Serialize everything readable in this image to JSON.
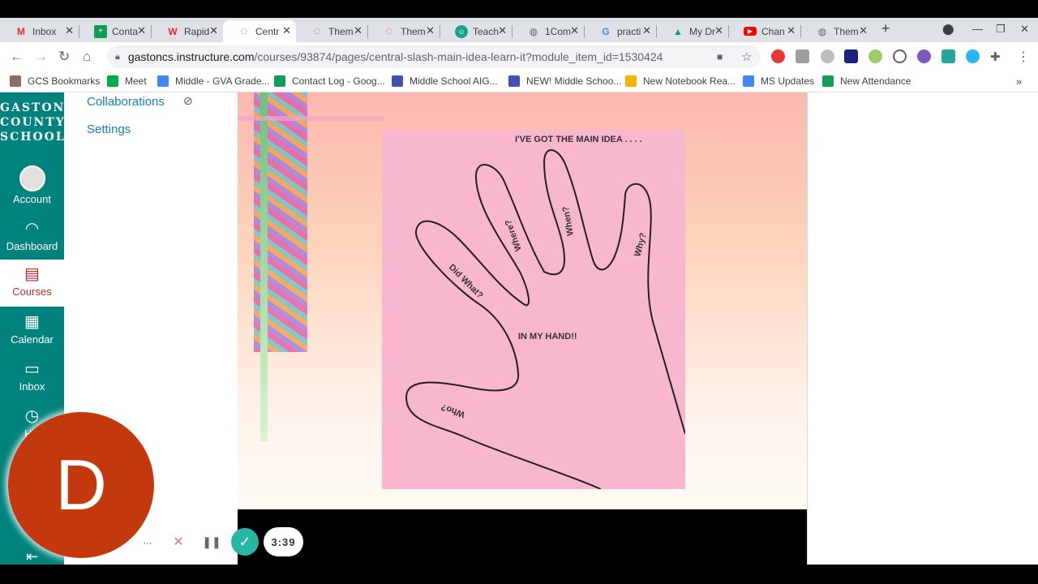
{
  "tabs": [
    {
      "icon": "gmail-icon",
      "label": "Inbox",
      "active": false
    },
    {
      "icon": "sheets-icon",
      "label": "Conta",
      "active": false
    },
    {
      "icon": "rapid-icon",
      "label": "Rapid",
      "active": false
    },
    {
      "icon": "canvas-icon",
      "label": "Centr",
      "active": true
    },
    {
      "icon": "canvas-icon",
      "label": "Them",
      "active": false
    },
    {
      "icon": "canvas-icon",
      "label": "Them",
      "active": false
    },
    {
      "icon": "teach-icon",
      "label": "Teach",
      "active": false
    },
    {
      "icon": "globe-icon",
      "label": "1Com",
      "active": false
    },
    {
      "icon": "google-icon",
      "label": "practi",
      "active": false
    },
    {
      "icon": "drive-icon",
      "label": "My Dr",
      "active": false
    },
    {
      "icon": "youtube-icon",
      "label": "Chan",
      "active": false
    },
    {
      "icon": "globe-icon",
      "label": "Them",
      "active": false
    }
  ],
  "address_bar": {
    "domain": "gastoncs.instructure.com",
    "path": "/courses/93874/pages/central-slash-main-idea-learn-it?module_item_id=1530424"
  },
  "bookmarks": [
    {
      "label": "GCS Bookmarks",
      "color": "#8d6e63"
    },
    {
      "label": "Meet",
      "color": "#00ac47"
    },
    {
      "label": "Middle - GVA Grade...",
      "color": "#4285f4"
    },
    {
      "label": "Contact Log - Goog...",
      "color": "#0f9d58"
    },
    {
      "label": "Middle School AIG...",
      "color": "#3f51b5"
    },
    {
      "label": "NEW! Middle Schoo...",
      "color": "#3f51b5"
    },
    {
      "label": "New Notebook Rea...",
      "color": "#f4b400"
    },
    {
      "label": "MS Updates",
      "color": "#4285f4"
    },
    {
      "label": "New Attendance",
      "color": "#0f9d58"
    }
  ],
  "global_nav": {
    "logo_lines": [
      "GASTON",
      "COUNTY",
      "SCHOOLS"
    ],
    "items": [
      {
        "label": "Account",
        "icon": "account-icon"
      },
      {
        "label": "Dashboard",
        "icon": "dashboard-icon"
      },
      {
        "label": "Courses",
        "icon": "courses-icon"
      },
      {
        "label": "Calendar",
        "icon": "calendar-icon"
      },
      {
        "label": "Inbox",
        "icon": "inbox-icon"
      },
      {
        "label": "His",
        "icon": "history-icon"
      }
    ],
    "active": "Courses"
  },
  "course_nav": {
    "collaborations": "Collaborations",
    "settings": "Settings"
  },
  "hand_image": {
    "title": "I'VE GOT THE MAIN IDEA . . . .",
    "thumb": "Who?",
    "index": "Did What?",
    "middle": "Where?",
    "ring": "When?",
    "pinky": "Why?",
    "palm": "IN MY HAND!!"
  },
  "recorder": {
    "avatar_letter": "D",
    "timer": "3:39"
  }
}
